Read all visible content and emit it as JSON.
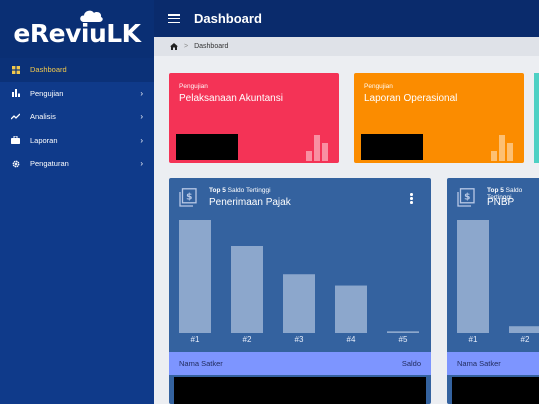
{
  "app": {
    "logo_text": "eReviuLK"
  },
  "header": {
    "title": "Dashboard"
  },
  "breadcrumb": {
    "current": "Dashboard"
  },
  "sidebar": {
    "items": [
      {
        "label": "Dashboard",
        "icon": "dashboard-icon",
        "active": true
      },
      {
        "label": "Pengujian",
        "icon": "bar-chart-icon"
      },
      {
        "label": "Analisis",
        "icon": "trend-line-icon"
      },
      {
        "label": "Laporan",
        "icon": "briefcase-icon"
      },
      {
        "label": "Pengaturan",
        "icon": "gear-icon"
      }
    ]
  },
  "stat_cards": [
    {
      "subtitle": "Pengujian",
      "title": "Pelaksanaan Akuntansi",
      "color": "#f43356"
    },
    {
      "subtitle": "Pengujian",
      "title": "Laporan Operasional",
      "color": "#fb8c00"
    }
  ],
  "charts": [
    {
      "subtitle_bold": "Top 5",
      "subtitle_rest": " Saldo Tertinggi",
      "title": "Penerimaan Pajak",
      "table_col1": "Nama Satker",
      "table_col2": "Saldo"
    },
    {
      "subtitle_bold": "Top 5",
      "subtitle_rest": " Saldo Tertinggi",
      "title": "PNBP",
      "table_col1": "Nama Satker"
    }
  ],
  "chart_data": [
    {
      "type": "bar",
      "categories": [
        "#1",
        "#2",
        "#3",
        "#4",
        "#5"
      ],
      "values": [
        100,
        77,
        52,
        42,
        1.5
      ],
      "ylim": [
        0,
        100
      ],
      "grid": false
    },
    {
      "type": "bar",
      "categories": [
        "#1",
        "#2"
      ],
      "values": [
        100,
        6
      ],
      "ylim": [
        0,
        100
      ],
      "grid": false
    }
  ]
}
